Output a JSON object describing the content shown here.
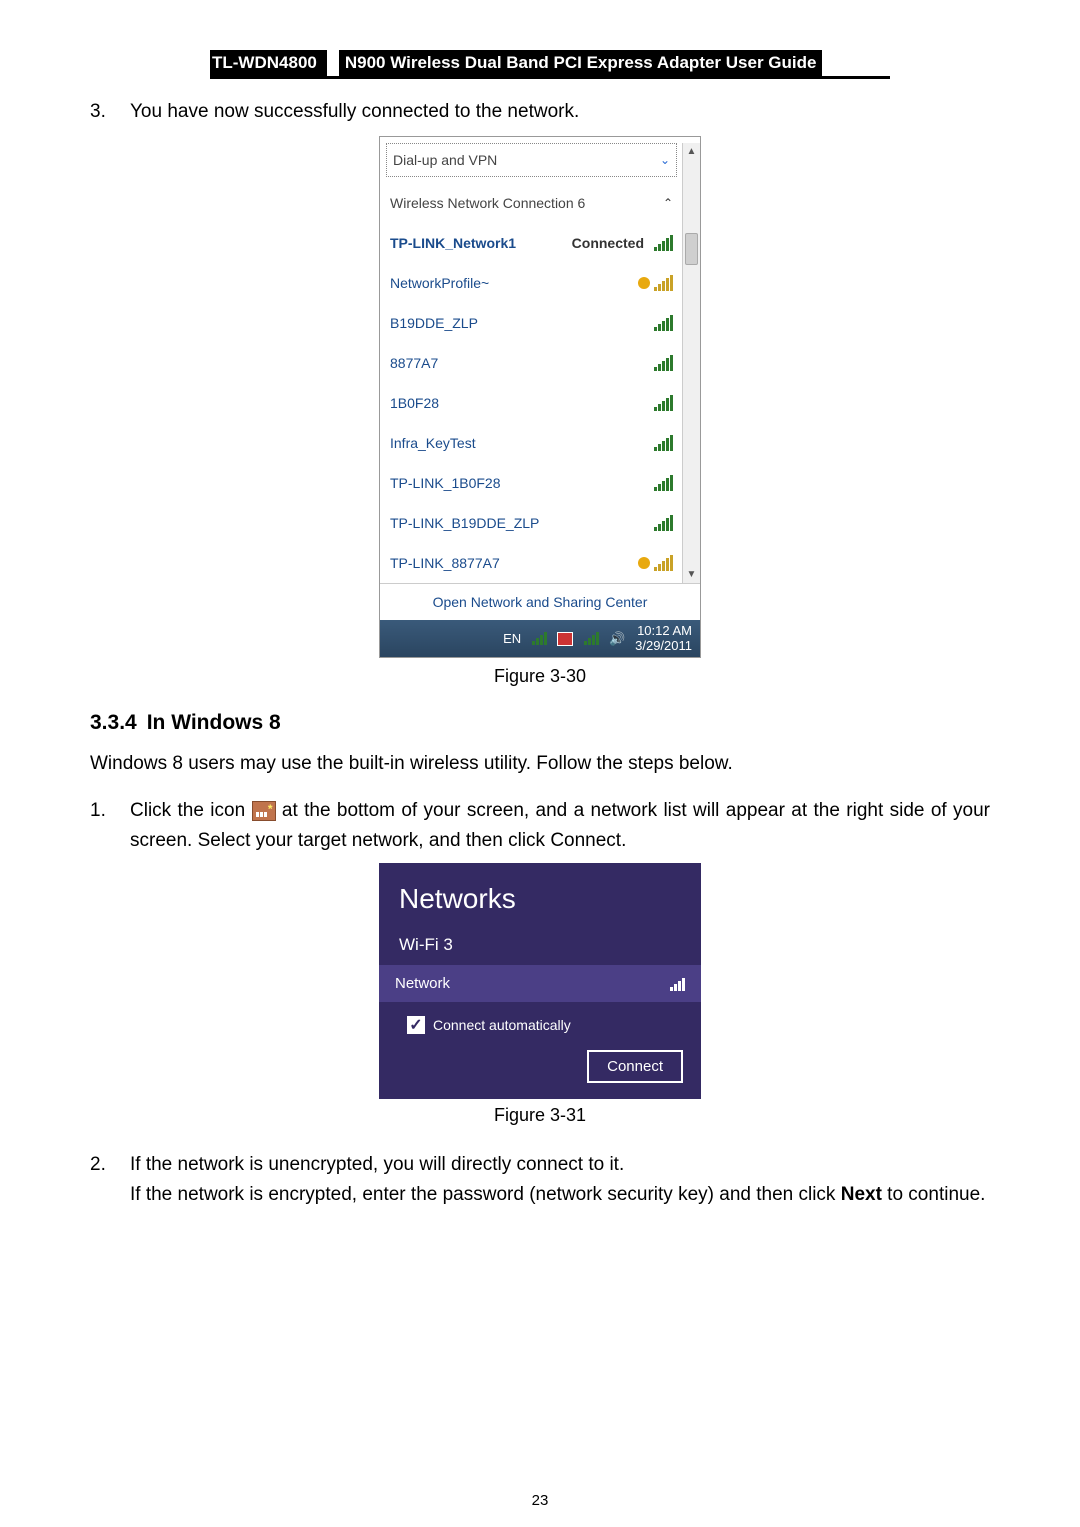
{
  "header": {
    "model": "TL-WDN4800",
    "title": "N900 Wireless Dual Band PCI Express Adapter User Guide"
  },
  "step3": {
    "number": "3.",
    "text": "You have now successfully connected to the network."
  },
  "win7": {
    "section_dialup": "Dial-up and VPN",
    "section_wireless": "Wireless Network Connection 6",
    "connected_label": "Connected",
    "networks": [
      {
        "name": "TP-LINK_Network1",
        "connected": true,
        "shield": false
      },
      {
        "name": "NetworkProfile~",
        "shield": true
      },
      {
        "name": "B19DDE_ZLP",
        "shield": false
      },
      {
        "name": "8877A7",
        "shield": false
      },
      {
        "name": "1B0F28",
        "shield": false
      },
      {
        "name": "Infra_KeyTest",
        "shield": false
      },
      {
        "name": "TP-LINK_1B0F28",
        "shield": false
      },
      {
        "name": "TP-LINK_B19DDE_ZLP",
        "shield": false
      },
      {
        "name": "TP-LINK_8877A7",
        "shield": true
      }
    ],
    "open_center": "Open Network and Sharing Center",
    "tray": {
      "lang": "EN",
      "time": "10:12 AM",
      "date": "3/29/2011"
    }
  },
  "fig30": "Figure 3-30",
  "section334": {
    "no": "3.3.4",
    "title": "In Windows 8",
    "intro": "Windows 8 users may use the built-in wireless utility. Follow the steps below.",
    "step1_no": "1.",
    "step1a": "Click the icon ",
    "step1b": " at the bottom of your screen, and a network list will appear at the right side of your screen. Select your target network, and then click Connect."
  },
  "win8": {
    "title": "Networks",
    "subhead": "Wi-Fi 3",
    "network_name": "Network",
    "auto_label": "Connect automatically",
    "connect": "Connect"
  },
  "fig31": "Figure 3-31",
  "step2": {
    "no": "2.",
    "line1": "If the network is unencrypted, you will directly connect to it.",
    "line2a": "If the network is encrypted, enter the password (network security key) and then click ",
    "line2b": "Next",
    "line2c": " to continue."
  },
  "page_number": "23"
}
